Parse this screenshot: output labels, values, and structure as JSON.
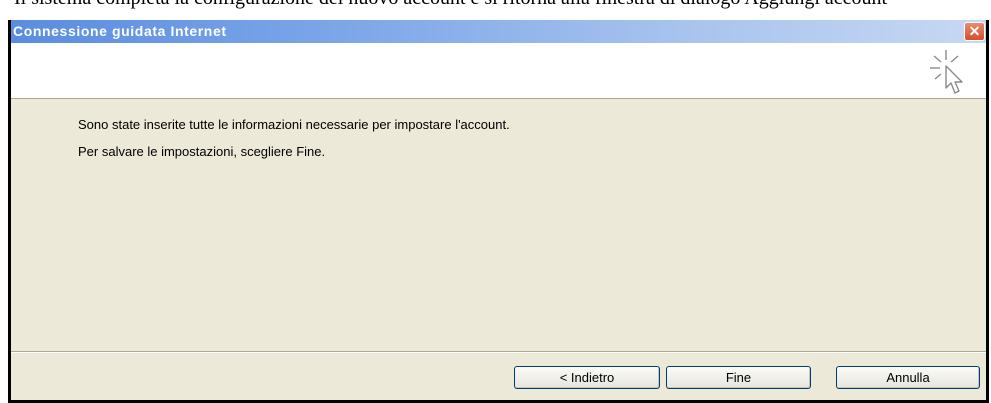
{
  "document": {
    "cropped_text": "Il sistema completa la configurazione del nuovo account e si ritorna alla finestra di dialogo Aggiungi account"
  },
  "window": {
    "title": "Connessione guidata Internet",
    "close_glyph": "✕"
  },
  "content": {
    "line1": "Sono state inserite tutte le informazioni necessarie per impostare l'account.",
    "line2": "Per salvare le impostazioni, scegliere Fine."
  },
  "buttons": {
    "back": "< Indietro",
    "finish": "Fine",
    "cancel": "Annulla"
  },
  "icons": {
    "wizard": "wizard-pointer-icon"
  }
}
